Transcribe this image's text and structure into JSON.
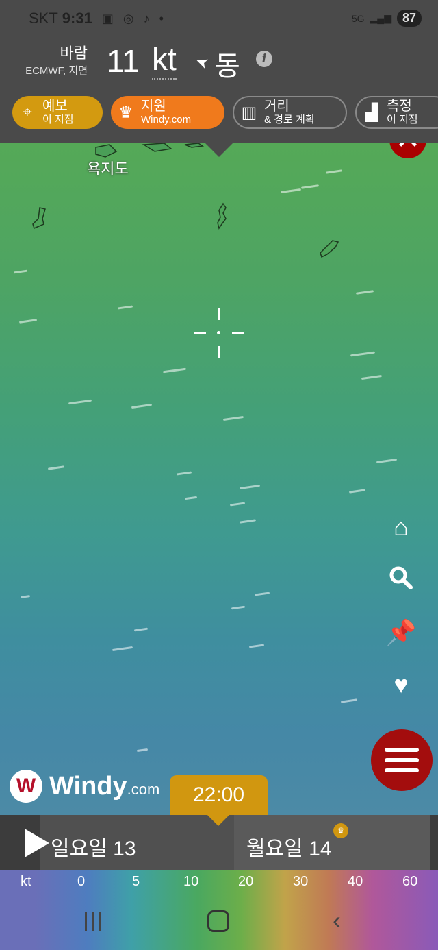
{
  "status_bar": {
    "carrier": "SKT",
    "time": "9:31",
    "network": "5G",
    "battery": "87"
  },
  "header": {
    "overlay_name": "바람",
    "overlay_sub": "ECMWF, 지면",
    "wind_speed": "11",
    "wind_unit": "kt",
    "wind_direction": "동",
    "info_label": "i"
  },
  "buttons": {
    "forecast": {
      "line1": "예보",
      "line2": "이 지점"
    },
    "support": {
      "line1": "지원",
      "line2": "Windy.com"
    },
    "distance": {
      "line1": "거리",
      "line2": "& 경로 계획"
    },
    "measure": {
      "line1": "측정",
      "line2": "이 지점"
    }
  },
  "map": {
    "island_label": "욕지도"
  },
  "logo": {
    "mark": "W",
    "text": "Windy",
    "suffix": ".com"
  },
  "timeline": {
    "current_time": "22:00",
    "day1": "일요일 13",
    "day2": "월요일 14"
  },
  "legend": {
    "unit": "kt",
    "values": [
      "0",
      "5",
      "10",
      "20",
      "30",
      "40",
      "60"
    ]
  },
  "colors": {
    "accent_orange": "#f07a1c",
    "accent_gold": "#d19710",
    "close_red": "#a00000",
    "header_bg": "#4a4a4a"
  }
}
